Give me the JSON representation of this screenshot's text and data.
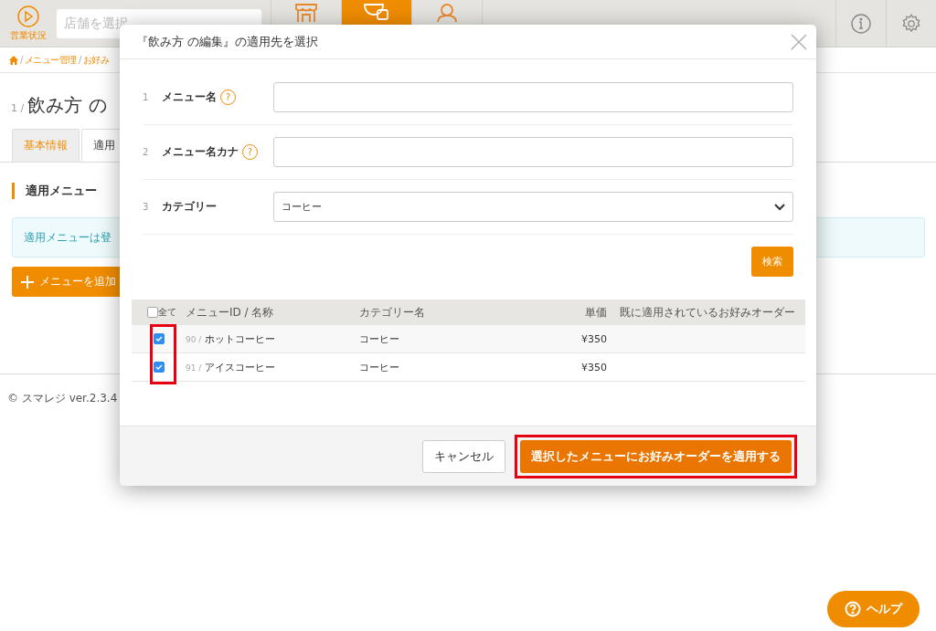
{
  "header": {
    "status_label": "営業状況",
    "store_select": {
      "placeholder": "店舗を選択"
    },
    "nav": [
      {
        "kind": "store",
        "selected": false
      },
      {
        "kind": "cup",
        "selected": true
      },
      {
        "kind": "person",
        "selected": false
      }
    ]
  },
  "breadcrumb": {
    "separator": "/",
    "items": [
      "メニュー管理",
      "お好み"
    ]
  },
  "page": {
    "number": "1 /",
    "title": "飲み方 の",
    "tabs": [
      {
        "label": "基本情報",
        "selected": false
      },
      {
        "label": "適用",
        "selected": true
      }
    ],
    "section_title": "適用メニュー",
    "notice": "適用メニューは登",
    "add_button": "メニューを追加"
  },
  "footer": "© スマレジ ver.2.3.4",
  "help_button": "ヘルプ",
  "dialog": {
    "title": "『飲み方 の編集』の適用先を選択",
    "fields": [
      {
        "number": "1",
        "label": "メニュー名",
        "help": "?",
        "kind": "text"
      },
      {
        "number": "2",
        "label": "メニュー名カナ",
        "help": "?",
        "kind": "text"
      },
      {
        "number": "3",
        "label": "カテゴリー",
        "kind": "select",
        "value": "コーヒー"
      }
    ],
    "search_button": "検索",
    "table": {
      "select_all": {
        "label": "全て",
        "checked": false
      },
      "columns": [
        "メニューID / 名称",
        "カテゴリー名",
        "単価",
        "既に適用されているお好みオーダー"
      ],
      "rows": [
        {
          "checked": true,
          "id": "90 /",
          "name": "ホットコーヒー",
          "category": "コーヒー",
          "price": "¥350"
        },
        {
          "checked": true,
          "id": "91 /",
          "name": "アイスコーヒー",
          "category": "コーヒー",
          "price": "¥350"
        }
      ]
    },
    "cancel_button": "キャンセル",
    "apply_button": "選択したメニューにお好みオーダーを適用する"
  }
}
